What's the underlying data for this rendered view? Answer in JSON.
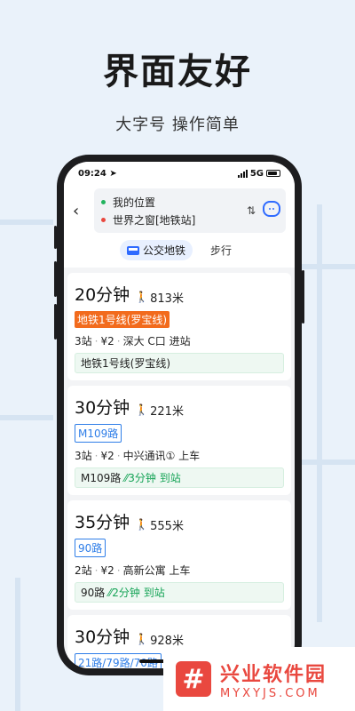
{
  "hero": {
    "title": "界面友好",
    "subtitle": "大字号 操作简单"
  },
  "status": {
    "time": "09:24",
    "network": "5G"
  },
  "header": {
    "origin": "我的位置",
    "destination": "世界之窗[地铁站]",
    "tabs": [
      {
        "label": "公交地铁",
        "active": true
      },
      {
        "label": "步行",
        "active": false
      }
    ]
  },
  "routes": [
    {
      "duration": "20分钟",
      "walk": "813米",
      "tag": "地铁1号线(罗宝线)",
      "tag_style": "fill",
      "stops": "3站",
      "price": "¥2",
      "board": "深大 C口 进站",
      "strip_line": "地铁1号线(罗宝线)",
      "strip_live": ""
    },
    {
      "duration": "30分钟",
      "walk": "221米",
      "tag": "M109路",
      "tag_style": "line",
      "stops": "3站",
      "price": "¥2",
      "board": "中兴通讯① 上车",
      "strip_line": "M109路",
      "strip_live": "3分钟 到站"
    },
    {
      "duration": "35分钟",
      "walk": "555米",
      "tag": "90路",
      "tag_style": "line",
      "stops": "2站",
      "price": "¥2",
      "board": "高新公寓 上车",
      "strip_line": "90路",
      "strip_live": "2分钟 到站"
    },
    {
      "duration": "30分钟",
      "walk": "928米",
      "tag": "21路/79路/70路",
      "tag_style": "line"
    }
  ],
  "watermark": {
    "cn": "兴业软件园",
    "en": "MYXYJS.COM",
    "logo": "#"
  },
  "colors": {
    "accent": "#2f6bff",
    "subway_tag": "#f26b1d",
    "live_green": "#15a356",
    "brand_red": "#e9483f"
  }
}
